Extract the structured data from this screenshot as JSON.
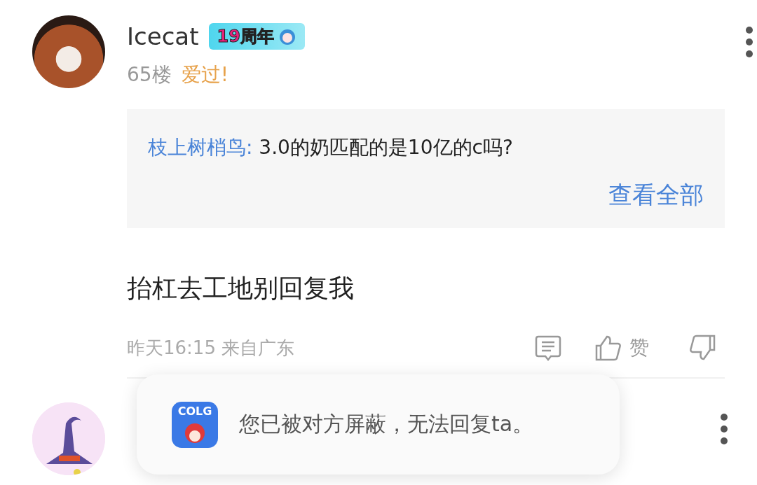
{
  "posts": [
    {
      "username": "Icecat",
      "badge": "19周年",
      "floor": "65楼",
      "title": "爱过!",
      "quote": {
        "author": "枝上树梢鸟:",
        "text": "3.0的奶匹配的是10亿的c吗?",
        "view_all": "查看全部"
      },
      "body": "抬杠去工地别回复我",
      "time": "昨天16:15 来自广东",
      "like_label": "赞",
      "kind": "photo"
    },
    {
      "kind": "cat"
    }
  ],
  "toast": {
    "message": "您已被对方屏蔽，无法回复ta。",
    "app_icon_text": "COLG"
  }
}
